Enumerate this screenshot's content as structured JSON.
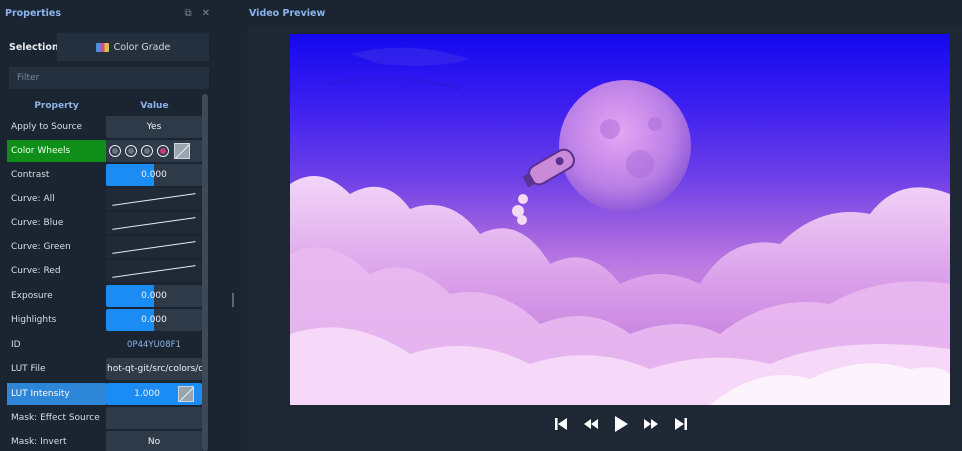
{
  "properties_panel": {
    "title": "Properties",
    "float_icon": "float-icon",
    "close_icon": "close-icon",
    "selection_label": "Selection:",
    "selection_value": "Color Grade",
    "selection_icon": "effect-icon",
    "filter_placeholder": "Filter",
    "columns": {
      "property": "Property",
      "value": "Value"
    },
    "rows": [
      {
        "property": "Apply to Source",
        "value": "Yes"
      },
      {
        "property": "Color Wheels",
        "value": "",
        "highlight_color": "#0f8f1a"
      },
      {
        "property": "Contrast",
        "value": "0.000",
        "fill_fraction": 0.5
      },
      {
        "property": "Curve: All",
        "value": ""
      },
      {
        "property": "Curve: Blue",
        "value": ""
      },
      {
        "property": "Curve: Green",
        "value": ""
      },
      {
        "property": "Curve: Red",
        "value": ""
      },
      {
        "property": "Exposure",
        "value": "0.000",
        "fill_fraction": 0.5
      },
      {
        "property": "Highlights",
        "value": "0.000",
        "fill_fraction": 0.5
      },
      {
        "property": "ID",
        "value": "0P44YU08F1"
      },
      {
        "property": "LUT File",
        "value": "hot-qt-git/src/colors/da"
      },
      {
        "property": "LUT Intensity",
        "value": "1.000",
        "fill_fraction": 1.0,
        "highlight_color": "#2d86d8"
      },
      {
        "property": "Mask: Effect Source",
        "value": ""
      },
      {
        "property": "Mask: Invert",
        "value": "No"
      }
    ]
  },
  "video_preview": {
    "title": "Video Preview",
    "controls": [
      "jump-start-icon",
      "rewind-icon",
      "play-icon",
      "fast-forward-icon",
      "jump-end-icon"
    ]
  },
  "colors": {
    "accent_text": "#8bb4ea",
    "slider_fill": "#1b8cf3",
    "background": "#1b2532"
  }
}
